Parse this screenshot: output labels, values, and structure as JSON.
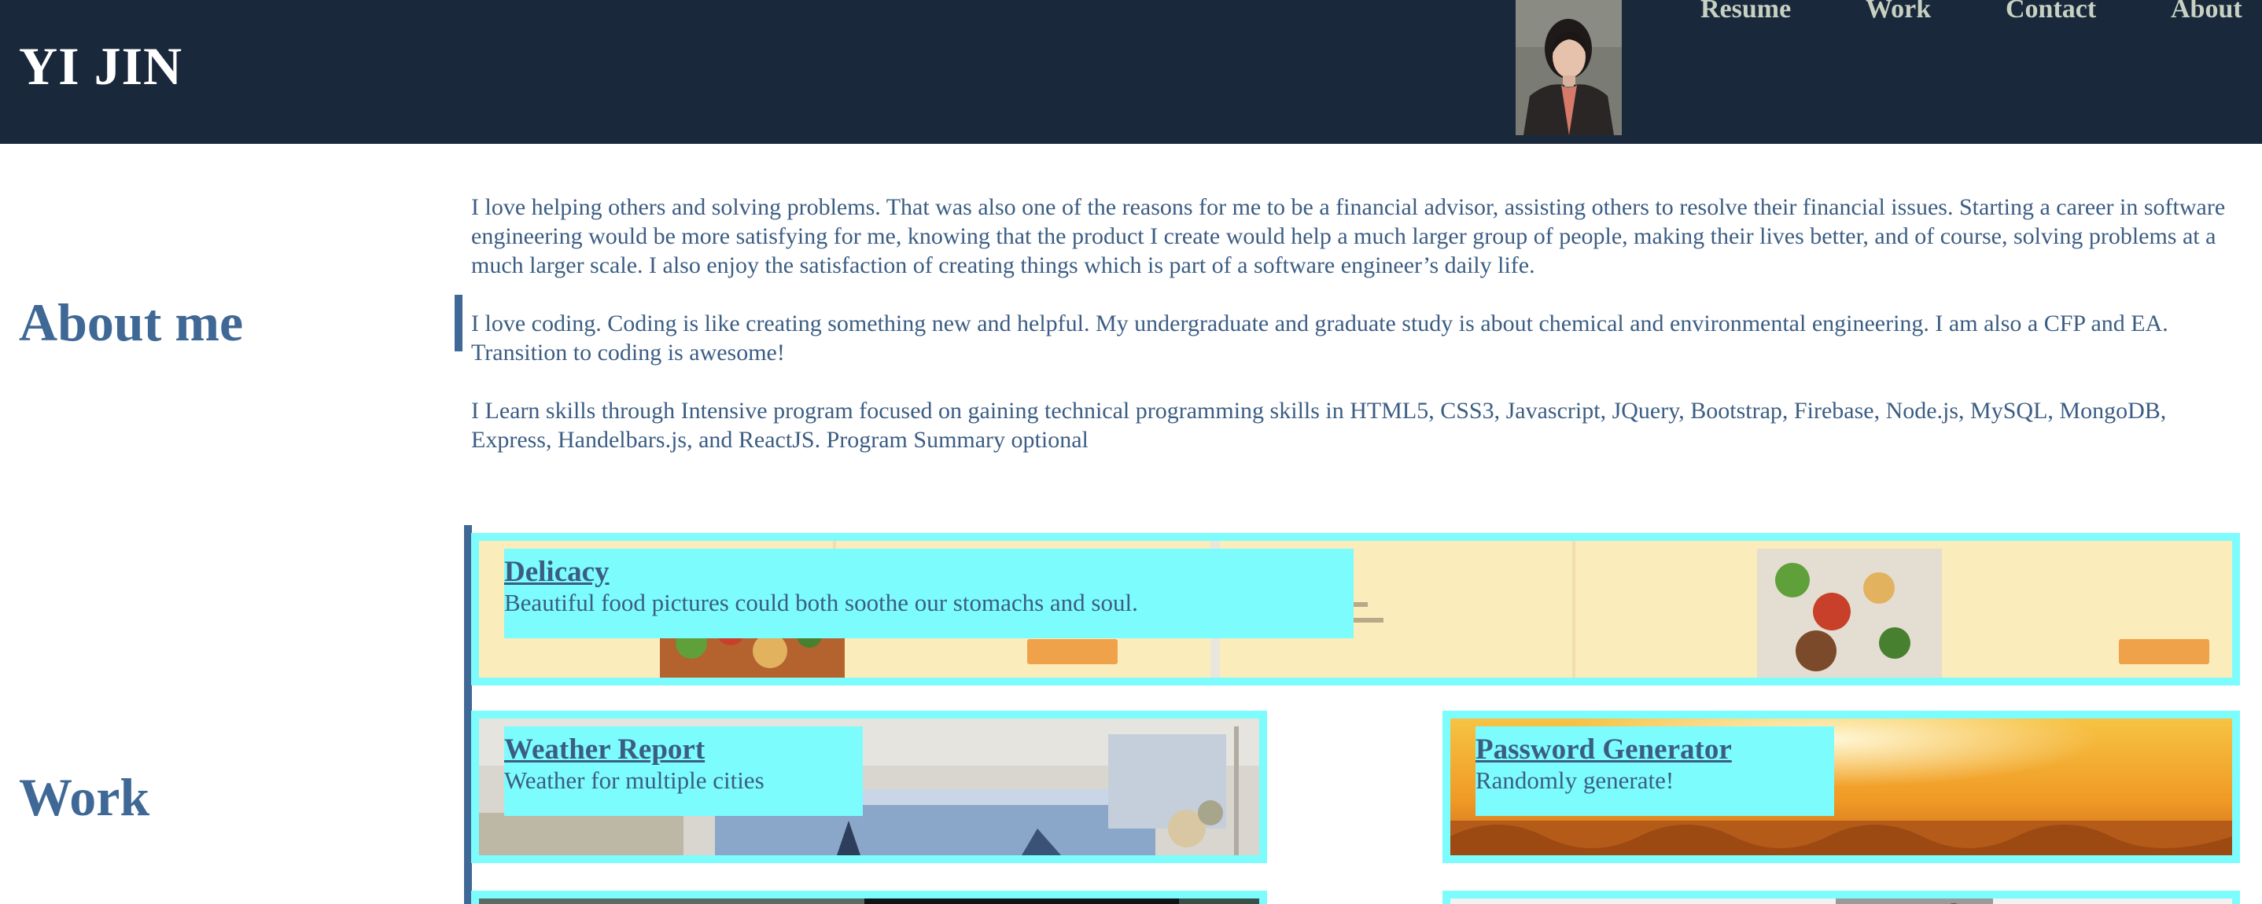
{
  "header": {
    "brand": "YI JIN",
    "nav": {
      "resume": "Resume",
      "work": "Work",
      "contact": "Contact",
      "about": "About"
    }
  },
  "about": {
    "title": "About me",
    "paragraphs": [
      "I love helping others and solving problems. That was also one of the reasons for me to be a financial advisor, assisting others to resolve their financial issues. Starting a career in software engineering would be more satisfying for me, knowing that the product I create would help a much larger group of people, making their lives better, and of course, solving problems at a much larger scale. I also enjoy the satisfaction of creating things which is part of a software engineer’s daily life.",
      "I love coding. Coding is like creating something new and helpful. My undergraduate and graduate study is about chemical and environmental engineering. I am also a CFP and EA. Transition to coding is awesome!",
      "I Learn skills through Intensive program focused on gaining technical programming skills in HTML5, CSS3, Javascript, JQuery, Bootstrap, Firebase, Node.js, MySQL, MongoDB, Express, Handelbars.js, and ReactJS. Program Summary optional"
    ]
  },
  "work": {
    "title": "Work",
    "projects": [
      {
        "title": "Delicacy",
        "description": "Beautiful food pictures could both soothe our stomachs and soul."
      },
      {
        "title": "Weather Report",
        "description": "Weather for multiple cities"
      },
      {
        "title": "Password Generator",
        "description": "Randomly generate!"
      }
    ]
  },
  "colors": {
    "header_bg": "#1a283b",
    "accent_blue": "#3f6896",
    "text_blue": "#3b5d83",
    "card_cyan": "#7cfcfd",
    "nav_text": "#c7d1c2"
  }
}
